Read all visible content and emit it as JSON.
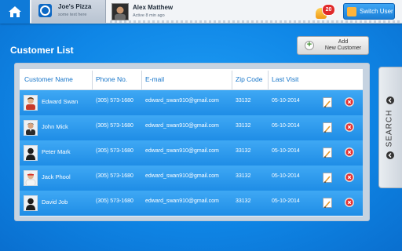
{
  "header": {
    "brand": {
      "name": "Joe's Pizza",
      "subtitle": "some text here"
    },
    "user": {
      "name": "Alex Matthew",
      "status": "Active 8 min ago"
    },
    "notifications": {
      "count": "20"
    },
    "switch_user_label": "Switch User"
  },
  "page": {
    "title": "Customer List",
    "add_button_label": "Add\nNew Customer"
  },
  "table": {
    "columns": [
      "Customer Name",
      "Phone No.",
      "E-mail",
      "Zip Code",
      "Last Visit"
    ],
    "rows": [
      {
        "name": "Edward Swan",
        "phone": "(305) 573-1680",
        "email": "edward_swan910@gmail.com",
        "zip": "33132",
        "last_visit": "05-10-2014",
        "avatar": "smiling-man"
      },
      {
        "name": "John Mick",
        "phone": "(305) 573-1680",
        "email": "edward_swan910@gmail.com",
        "zip": "33132",
        "last_visit": "05-10-2014",
        "avatar": "man-dark-suit"
      },
      {
        "name": "Peter Mark",
        "phone": "(305) 573-1680",
        "email": "edward_swan910@gmail.com",
        "zip": "33132",
        "last_visit": "05-10-2014",
        "avatar": "silhouette"
      },
      {
        "name": "Jack Phool",
        "phone": "(305) 573-1680",
        "email": "edward_swan910@gmail.com",
        "zip": "33132",
        "last_visit": "05-10-2014",
        "avatar": "man-headband"
      },
      {
        "name": "David Job",
        "phone": "(305) 573-1680",
        "email": "edward_swan910@gmail.com",
        "zip": "33132",
        "last_visit": "05-10-2014",
        "avatar": "silhouette"
      }
    ]
  },
  "search_tab": {
    "label": "SEARCH"
  },
  "colors": {
    "background": "#1a93ef",
    "row": "#2e9bee",
    "header_text": "#1675c9",
    "delete_red": "#e53030"
  }
}
